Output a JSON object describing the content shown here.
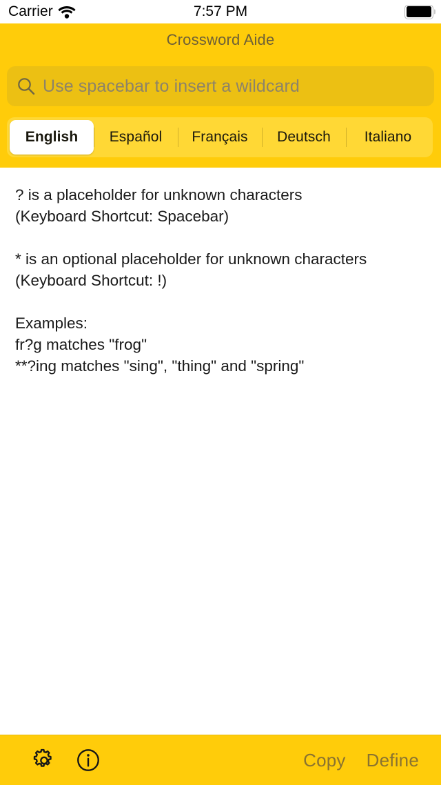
{
  "status_bar": {
    "carrier": "Carrier",
    "wifi_icon": "wifi-icon",
    "time": "7:57 PM",
    "battery_icon": "battery-full-icon"
  },
  "header": {
    "title": "Crossword Aide",
    "background_color": "#FFCC0A",
    "search": {
      "icon": "search-icon",
      "placeholder": "Use spacebar to insert a wildcard",
      "value": ""
    },
    "language_segments": [
      {
        "label": "English",
        "selected": true
      },
      {
        "label": "Español",
        "selected": false
      },
      {
        "label": "Français",
        "selected": false
      },
      {
        "label": "Deutsch",
        "selected": false
      },
      {
        "label": "Italiano",
        "selected": false
      }
    ]
  },
  "content": {
    "help_text": "? is a placeholder for unknown characters\n(Keyboard Shortcut: Spacebar)\n\n* is an optional placeholder for unknown characters\n(Keyboard Shortcut: !)\n\nExamples:\nfr?g matches \"frog\"\n**?ing matches \"sing\", \"thing\" and \"spring\""
  },
  "toolbar": {
    "settings_icon": "gear-icon",
    "info_icon": "info-circle-icon",
    "copy_label": "Copy",
    "define_label": "Define",
    "disabled_color": "#8a7330"
  }
}
